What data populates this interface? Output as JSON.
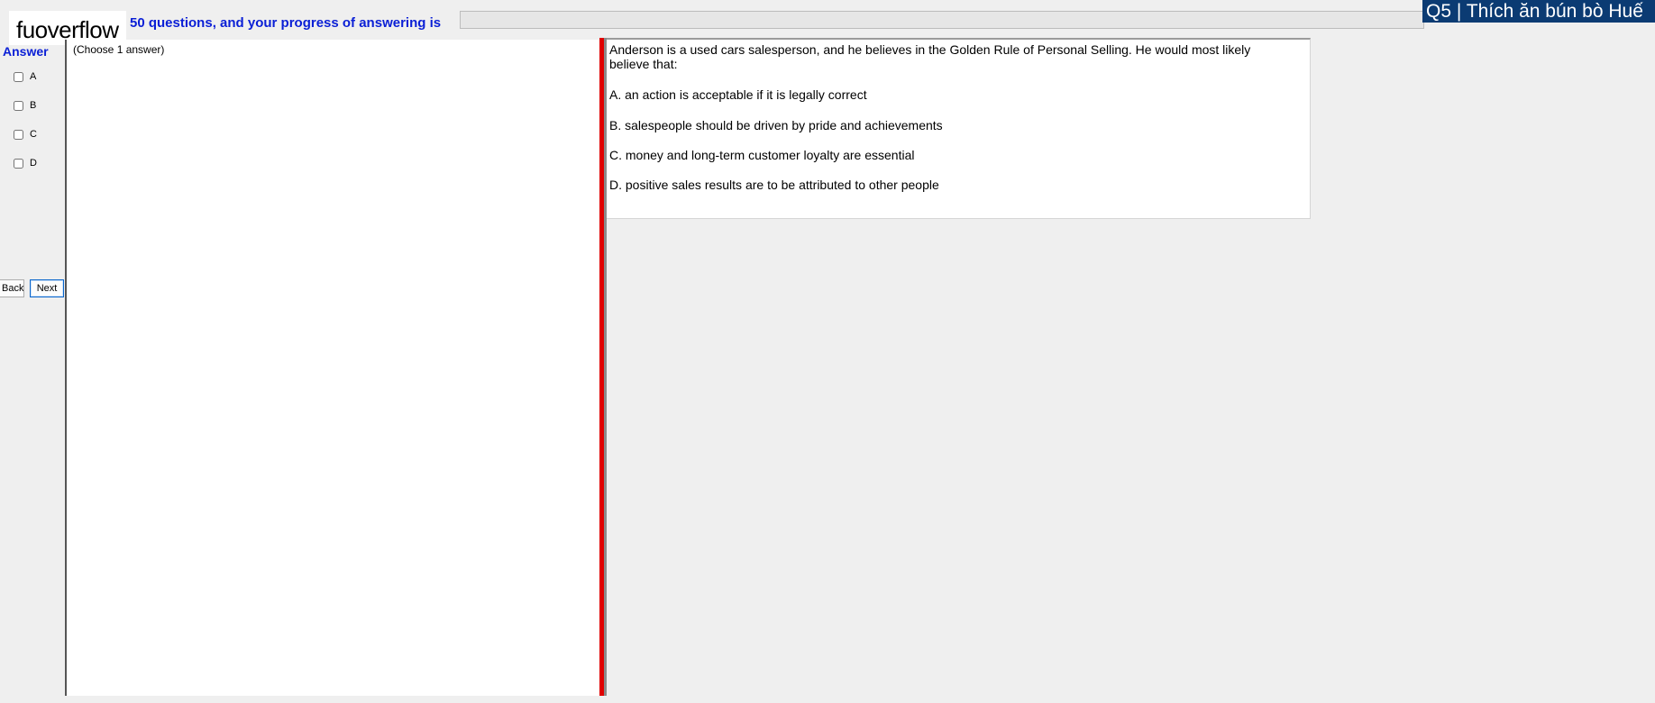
{
  "header": {
    "brand": "fuoverflow",
    "progress_text": "50 questions, and your progress of answering is",
    "progress_value": 0,
    "title": "Q5 | Thích ăn bún bò Huế"
  },
  "answer_panel": {
    "title": "Answer",
    "choices": [
      "A",
      "B",
      "C",
      "D"
    ],
    "back_label": "Back",
    "next_label": "Next"
  },
  "middle": {
    "instruction": "(Choose 1 answer)"
  },
  "question": {
    "text": "Anderson is a used cars salesperson, and he believes in the Golden Rule of Personal Selling. He would most likely believe that:",
    "options": [
      "A.  an action is acceptable if it is legally correct",
      "B.  salespeople should be driven by pride and achievements",
      "C.  money and long-term customer loyalty are essential",
      "D.  positive sales results are to be attributed to other people"
    ]
  },
  "colors": {
    "accent_blue": "#0a1fd6",
    "title_bg": "#0b3b73",
    "divider_red": "#e00000"
  }
}
